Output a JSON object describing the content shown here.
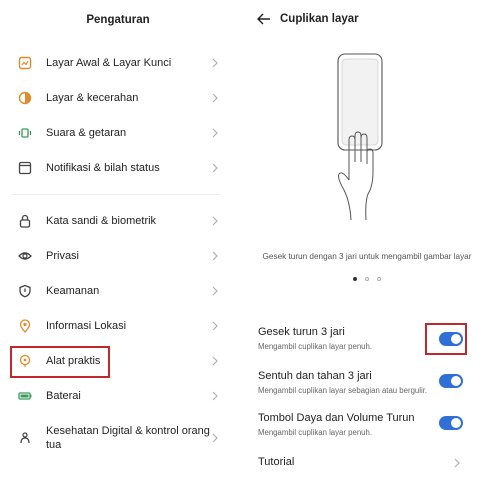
{
  "settings": {
    "title": "Pengaturan",
    "groups": [
      [
        {
          "label": "Layar Awal & Layar Kunci",
          "icon": "home-screen-icon"
        },
        {
          "label": "Layar & kecerahan",
          "icon": "brightness-icon"
        },
        {
          "label": "Suara & getaran",
          "icon": "sound-icon"
        },
        {
          "label": "Notifikasi & bilah status",
          "icon": "notification-icon"
        }
      ],
      [
        {
          "label": "Kata sandi & biometrik",
          "icon": "lock-icon"
        },
        {
          "label": "Privasi",
          "icon": "privacy-eye-icon"
        },
        {
          "label": "Keamanan",
          "icon": "shield-icon"
        },
        {
          "label": "Informasi Lokasi",
          "icon": "location-icon"
        },
        {
          "label": "Alat praktis",
          "icon": "tools-icon",
          "highlighted": true
        },
        {
          "label": "Baterai",
          "icon": "battery-icon"
        },
        {
          "label": "Kesehatan Digital & kontrol orang tua",
          "icon": "digital-wellbeing-icon"
        }
      ]
    ]
  },
  "screenshot_page": {
    "title": "Cuplikan layar",
    "illustration_caption": "Gesek turun dengan 3 jari untuk mengambil gambar layar",
    "carousel": {
      "count": 3,
      "active": 0
    },
    "options": [
      {
        "title": "Gesek turun 3 jari",
        "subtitle": "Mengambil cuplikan layar penuh.",
        "enabled": true,
        "highlighted": true
      },
      {
        "title": "Sentuh dan tahan 3 jari",
        "subtitle": "Mengambil cuplikan layar sebagian atau bergulir.",
        "enabled": true
      },
      {
        "title": "Tombol Daya dan Volume Turun",
        "subtitle": "Mengambil cuplikan layar penuh.",
        "enabled": true
      }
    ],
    "tutorial_label": "Tutorial"
  },
  "colors": {
    "accent": "#2f6fd6",
    "highlight": "#c0282b"
  }
}
